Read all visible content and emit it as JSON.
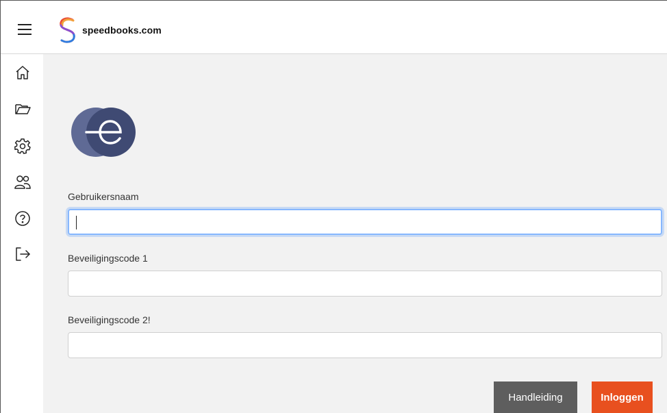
{
  "app": {
    "brand_name": "speedbooks.com",
    "accent_color": "#e8501f",
    "logo_color": "#3f4a73"
  },
  "topbar": {
    "menu_icon": "hamburger-menu-icon"
  },
  "sidebar": {
    "items": [
      {
        "icon": "home-icon"
      },
      {
        "icon": "folder-icon"
      },
      {
        "icon": "gear-icon"
      },
      {
        "icon": "users-icon"
      },
      {
        "icon": "help-icon"
      },
      {
        "icon": "logout-icon"
      }
    ]
  },
  "form": {
    "username": {
      "label": "Gebruikersnaam",
      "value": ""
    },
    "code1": {
      "label": "Beveiligingscode 1",
      "value": ""
    },
    "code2": {
      "label": "Beveiligingscode 2!",
      "value": ""
    }
  },
  "actions": {
    "manual_label": "Handleiding",
    "login_label": "Inloggen"
  }
}
